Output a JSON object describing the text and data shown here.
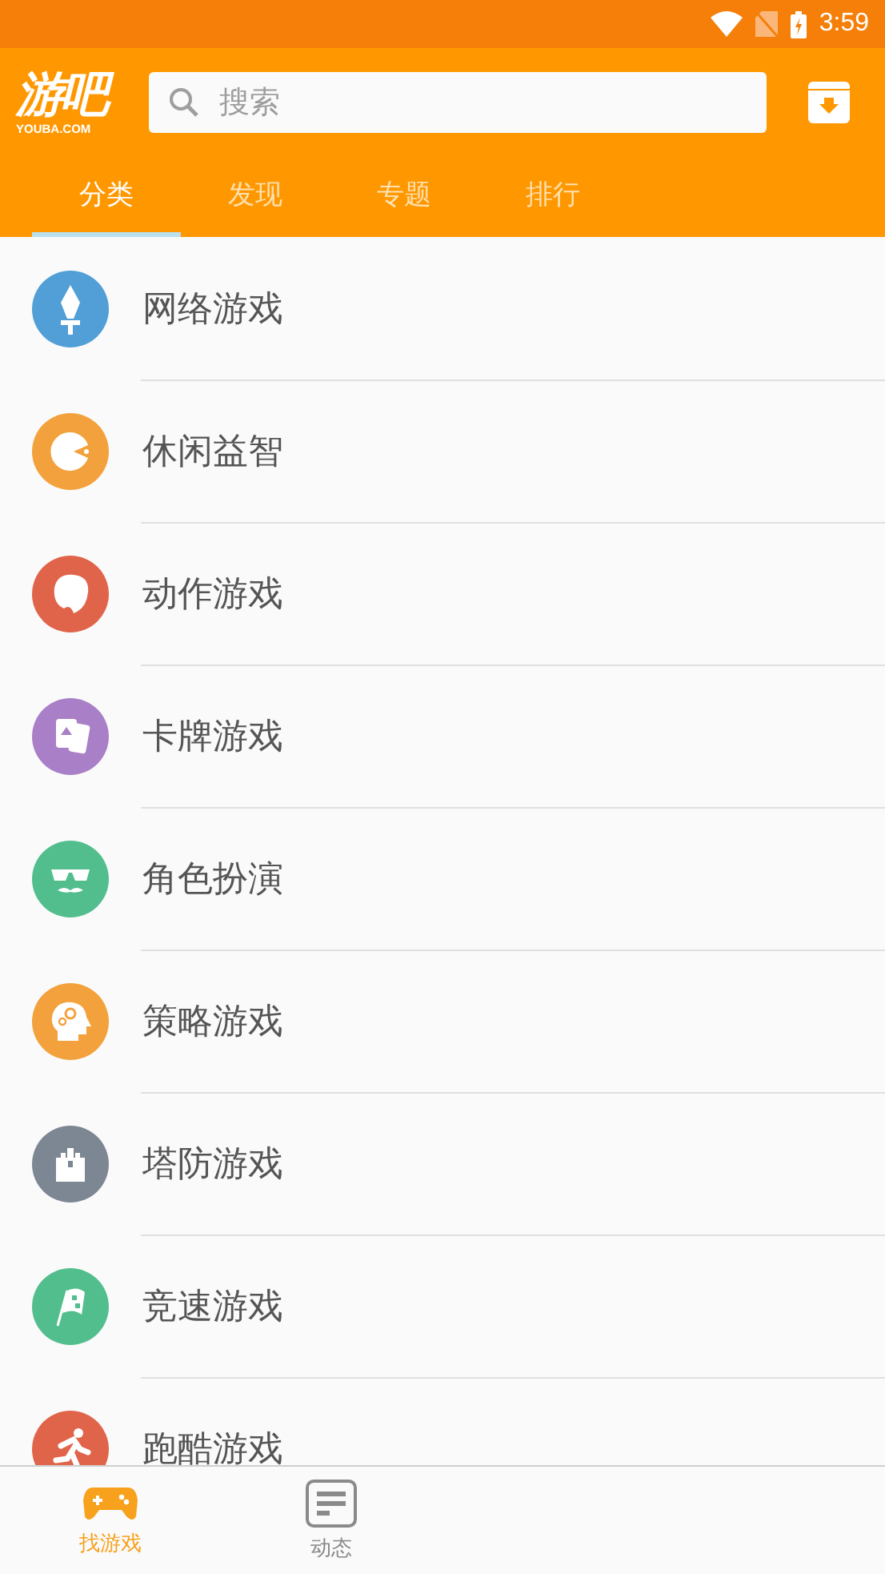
{
  "status_bar": {
    "time": "3:59"
  },
  "header": {
    "logo": {
      "title": "游吧",
      "subtitle": "YOUBA.COM"
    },
    "search": {
      "placeholder": "搜索"
    }
  },
  "tabs": [
    {
      "label": "分类",
      "selected": true
    },
    {
      "label": "发现",
      "selected": false
    },
    {
      "label": "专题",
      "selected": false
    },
    {
      "label": "排行",
      "selected": false
    }
  ],
  "categories": [
    {
      "label": "网络游戏",
      "color": "#519fd6"
    },
    {
      "label": "休闲益智",
      "color": "#f3a13c"
    },
    {
      "label": "动作游戏",
      "color": "#e0644a"
    },
    {
      "label": "卡牌游戏",
      "color": "#a97fc8"
    },
    {
      "label": "角色扮演",
      "color": "#52be8d"
    },
    {
      "label": "策略游戏",
      "color": "#f3a13c"
    },
    {
      "label": "塔防游戏",
      "color": "#7d8793"
    },
    {
      "label": "竞速游戏",
      "color": "#52be8d"
    },
    {
      "label": "跑酷游戏",
      "color": "#e0644a"
    }
  ],
  "bottom_nav": [
    {
      "label": "找游戏",
      "selected": true
    },
    {
      "label": "动态",
      "selected": false
    }
  ]
}
